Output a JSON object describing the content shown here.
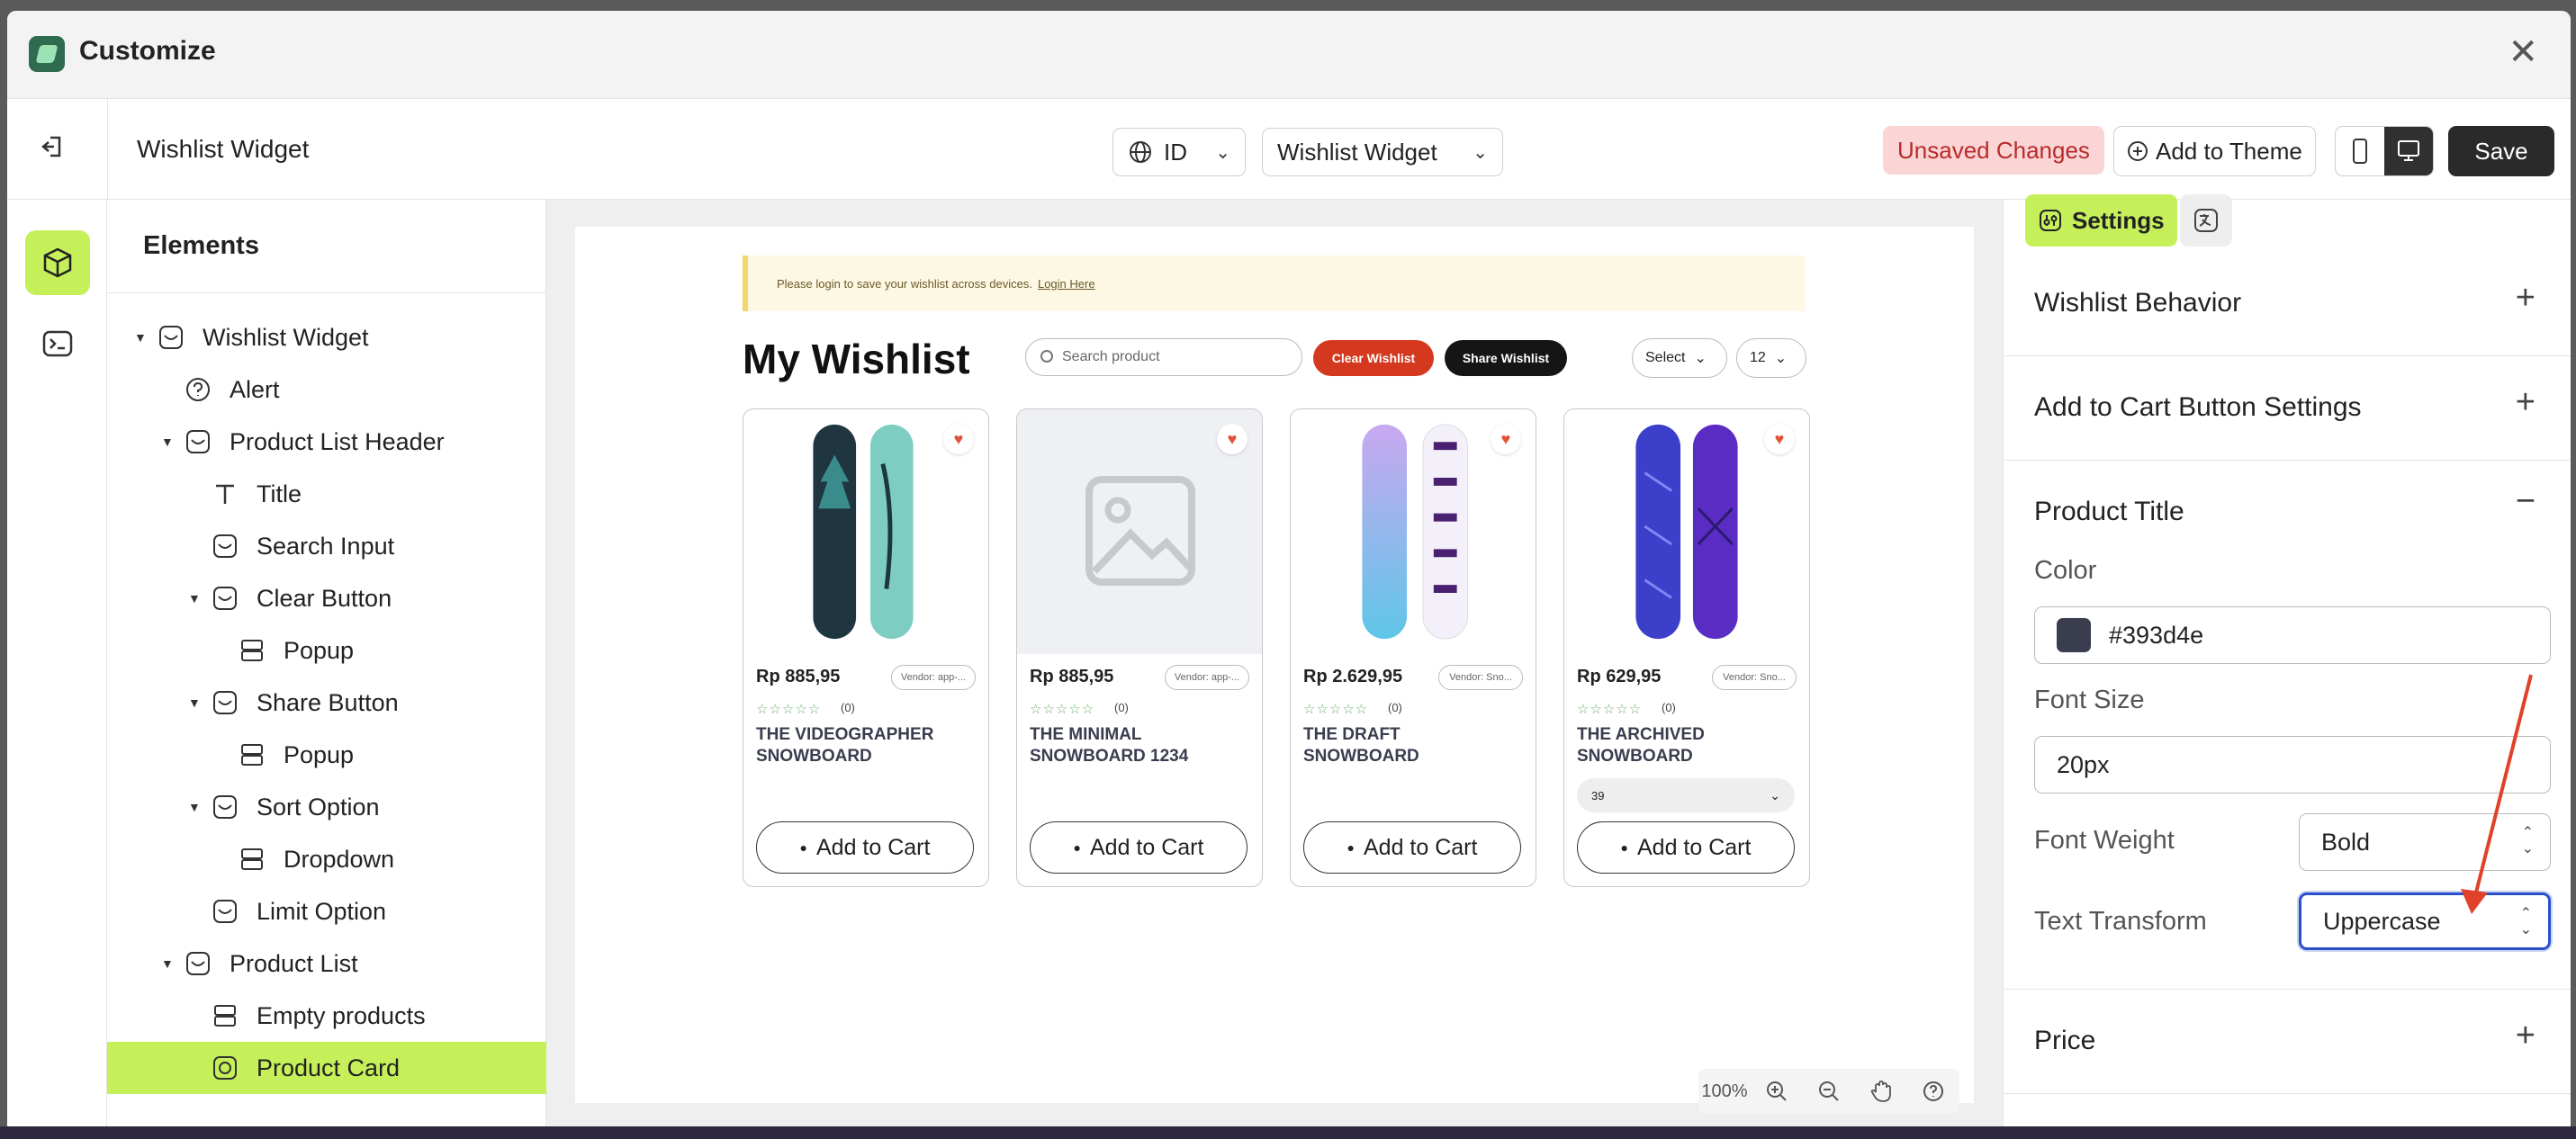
{
  "window": {
    "title": "Customize"
  },
  "toolbar": {
    "page_name": "Wishlist Widget",
    "language": "ID",
    "template": "Wishlist Widget",
    "unsaved": "Unsaved Changes",
    "add_to_theme": "Add to Theme",
    "save": "Save"
  },
  "tree": {
    "heading": "Elements",
    "items": [
      {
        "label": "Wishlist Widget"
      },
      {
        "label": "Alert"
      },
      {
        "label": "Product List Header"
      },
      {
        "label": "Title"
      },
      {
        "label": "Search Input"
      },
      {
        "label": "Clear Button"
      },
      {
        "label": "Popup"
      },
      {
        "label": "Share Button"
      },
      {
        "label": "Popup"
      },
      {
        "label": "Sort Option"
      },
      {
        "label": "Dropdown"
      },
      {
        "label": "Limit Option"
      },
      {
        "label": "Product List"
      },
      {
        "label": "Empty products"
      },
      {
        "label": "Product Card"
      }
    ],
    "selected": "Product Card"
  },
  "preview": {
    "alert_text": "Please login to save your wishlist across devices.",
    "alert_link": "Login Here",
    "title": "My Wishlist",
    "search_placeholder": "Search product",
    "clear_label": "Clear Wishlist",
    "share_label": "Share Wishlist",
    "sort_value": "Select",
    "limit_value": "12",
    "zoom": "100%",
    "cards": [
      {
        "price": "Rp 885,95",
        "vendor": "Vendor: app-...",
        "reviews": "(0)",
        "name": "THE VIDEOGRAPHER SNOWBOARD",
        "button": "Add to Cart"
      },
      {
        "price": "Rp 885,95",
        "vendor": "Vendor: app-...",
        "reviews": "(0)",
        "name": "THE MINIMAL SNOWBOARD 1234",
        "button": "Add to Cart"
      },
      {
        "price": "Rp 2.629,95",
        "vendor": "Vendor: Sno...",
        "reviews": "(0)",
        "name": "THE DRAFT SNOWBOARD",
        "button": "Add to Cart"
      },
      {
        "price": "Rp 629,95",
        "vendor": "Vendor: Sno...",
        "reviews": "(0)",
        "name": "THE ARCHIVED SNOWBOARD",
        "variant": "39",
        "button": "Add to Cart"
      }
    ]
  },
  "settings": {
    "tab_label": "Settings",
    "sections": {
      "wishlist_behavior": "Wishlist Behavior",
      "add_to_cart": "Add to Cart Button Settings",
      "product_title": "Product Title",
      "price": "Price"
    },
    "color_label": "Color",
    "color_value": "#393d4e",
    "font_size_label": "Font Size",
    "font_size_value": "20px",
    "font_weight_label": "Font Weight",
    "font_weight_value": "Bold",
    "text_transform_label": "Text Transform",
    "text_transform_value": "Uppercase"
  },
  "colors": {
    "accent": "#c6f05a",
    "title_color": "#393d4e",
    "clear_button": "#d4381e",
    "focus": "#2a4fc9"
  }
}
